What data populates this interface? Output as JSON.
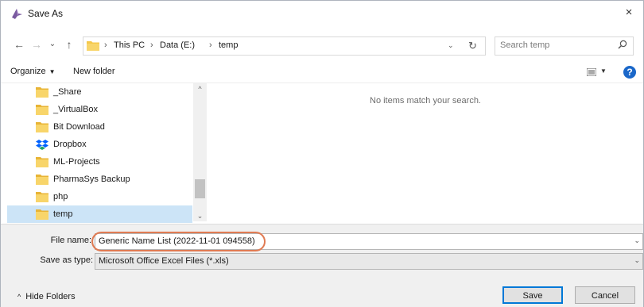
{
  "window": {
    "title": "Save As",
    "close_label": "×"
  },
  "nav": {
    "back": "←",
    "forward": "→",
    "recent": "⌄",
    "up": "↑",
    "breadcrumb": [
      "This PC",
      "Data (E:)",
      "temp"
    ],
    "separator": "›",
    "dropdown": "⌄",
    "refresh": "↻",
    "search_placeholder": "Search temp"
  },
  "toolbar": {
    "organize": "Organize",
    "organize_caret": "▼",
    "new_folder": "New folder",
    "view_caret": "▼",
    "help": "?"
  },
  "sidebar": {
    "items": [
      {
        "label": "_Share",
        "icon": "folder-icon"
      },
      {
        "label": "_VirtualBox",
        "icon": "folder-icon"
      },
      {
        "label": "Bit Download",
        "icon": "folder-icon"
      },
      {
        "label": "Dropbox",
        "icon": "dropbox-icon"
      },
      {
        "label": "ML-Projects",
        "icon": "folder-icon"
      },
      {
        "label": "PharmaSys Backup",
        "icon": "folder-icon"
      },
      {
        "label": "php",
        "icon": "folder-icon"
      },
      {
        "label": "temp",
        "icon": "folder-icon",
        "selected": true
      }
    ],
    "scroll_up": "^",
    "scroll_down": "⌄"
  },
  "content": {
    "empty_message": "No items match your search."
  },
  "form": {
    "file_name_label": "File name:",
    "file_name_value": "Generic Name List (2022-11-01 094558)",
    "save_as_type_label": "Save as type:",
    "save_as_type_value": "Microsoft Office Excel Files (*.xls)",
    "dropdown_arrow": "⌄"
  },
  "footer": {
    "hide_folders": "Hide Folders",
    "hide_chevron": "^",
    "save": "Save",
    "cancel": "Cancel"
  },
  "colors": {
    "accent": "#0078d7",
    "highlight_outline": "#e07b53",
    "folder": "#f5c84b",
    "selected_row": "#cce4f7"
  }
}
